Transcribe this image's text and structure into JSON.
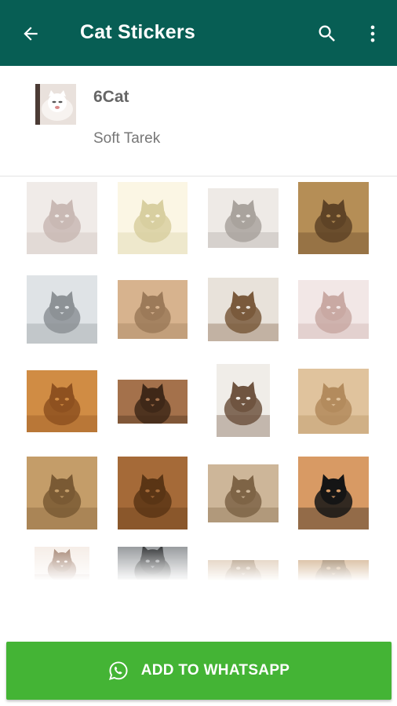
{
  "appbar": {
    "title": "Cat Stickers",
    "background": "#075e54",
    "icons": {
      "back": "arrow-back-icon",
      "search": "search-icon",
      "more": "more-vert-icon"
    }
  },
  "pack": {
    "name": "6Cat",
    "publisher": "Soft Tarek",
    "thumbnail": "cat-sticker-tray-icon"
  },
  "stickers": [
    {
      "name": "white cat yawning",
      "colors": [
        "#f0ebe8",
        "#c9b9b4"
      ]
    },
    {
      "name": "fluffy white kitten",
      "colors": [
        "#fbf6e4",
        "#d8cfa0"
      ]
    },
    {
      "name": "cat under blanket",
      "colors": [
        "#eeeae6",
        "#a9a39d"
      ]
    },
    {
      "name": "tabby kitten sleeping",
      "colors": [
        "#b58e56",
        "#5e4326"
      ]
    },
    {
      "name": "white kitten standing",
      "colors": [
        "#dfe3e6",
        "#8d9296"
      ]
    },
    {
      "name": "orange cat sitting",
      "colors": [
        "#d7b38e",
        "#9c7a59"
      ]
    },
    {
      "name": "cat thinking bubble",
      "colors": [
        "#e8e2da",
        "#7a5a3c"
      ]
    },
    {
      "name": "cat licking paw",
      "colors": [
        "#f2e7e6",
        "#c9a9a3"
      ]
    },
    {
      "name": "orange cat lying",
      "colors": [
        "#d08c44",
        "#8e5120"
      ]
    },
    {
      "name": "cat with milk bottle",
      "colors": [
        "#a4714b",
        "#3f2818"
      ]
    },
    {
      "name": "cat tail curled",
      "colors": [
        "#f0ede8",
        "#6f5440"
      ]
    },
    {
      "name": "kitten in box",
      "colors": [
        "#e0c39d",
        "#b38b5d"
      ]
    },
    {
      "name": "cat in hood",
      "colors": [
        "#c49d69",
        "#7a5a34"
      ]
    },
    {
      "name": "persian cat face",
      "colors": [
        "#a56a38",
        "#5a3515"
      ]
    },
    {
      "name": "cat in room",
      "colors": [
        "#cdb699",
        "#7e6446"
      ]
    },
    {
      "name": "scottish fold kitten",
      "colors": [
        "#d89a64",
        "#151515"
      ]
    },
    {
      "name": "white kitten",
      "colors": [
        "#f6eee8",
        "#a98a78"
      ]
    },
    {
      "name": "cat in car",
      "colors": [
        "#9b9ea1",
        "#3d3f41"
      ]
    },
    {
      "name": "cat partial",
      "colors": [
        "#d8c1a8",
        "#a38769"
      ]
    },
    {
      "name": "cat partial 2",
      "colors": [
        "#c9a277",
        "#8c6a45"
      ]
    }
  ],
  "add_button": {
    "label": "ADD TO WHATSAPP",
    "icon": "whatsapp-icon",
    "color": "#44b435"
  }
}
